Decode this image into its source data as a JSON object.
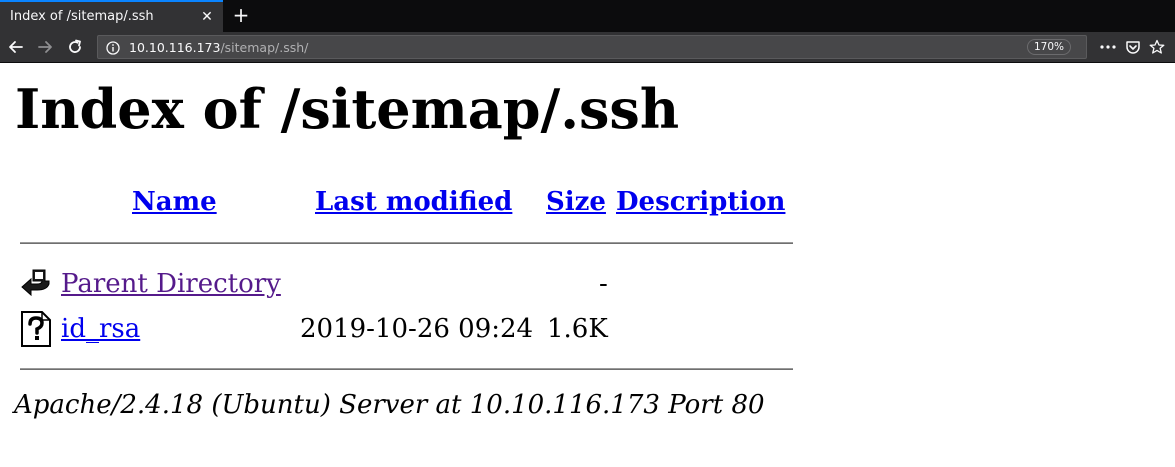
{
  "browser": {
    "tab_title": "Index of /sitemap/.ssh",
    "tab_close_glyph": "✕",
    "newtab_glyph": "+",
    "url_host": "10.10.116.173",
    "url_path": "/sitemap/.ssh/",
    "zoom": "170%",
    "icons": {
      "back": "back-arrow-icon",
      "forward": "forward-arrow-icon",
      "reload": "reload-icon",
      "info": "info-icon",
      "more": "more-dots-icon",
      "pocket": "pocket-icon",
      "bookmark": "star-icon"
    },
    "colors": {
      "tab_accent": "#0a84ff",
      "chrome_dark": "#0c0c0d",
      "chrome": "#323234"
    }
  },
  "page": {
    "title": "Index of /sitemap/.ssh",
    "columns": {
      "name": "Name",
      "last_modified": "Last modified",
      "size": "Size",
      "description": "Description"
    },
    "rows": [
      {
        "icon": "back-folder-icon",
        "name": "Parent Directory",
        "last_modified": "",
        "size": "-",
        "description": ""
      },
      {
        "icon": "unknown-file-icon",
        "name": "id_rsa",
        "last_modified": "2019-10-26 09:24",
        "size": "1.6K",
        "description": ""
      }
    ],
    "footer": "Apache/2.4.18 (Ubuntu) Server at 10.10.116.173 Port 80",
    "colors": {
      "link": "#0000ee",
      "visited": "#551a8b"
    }
  }
}
